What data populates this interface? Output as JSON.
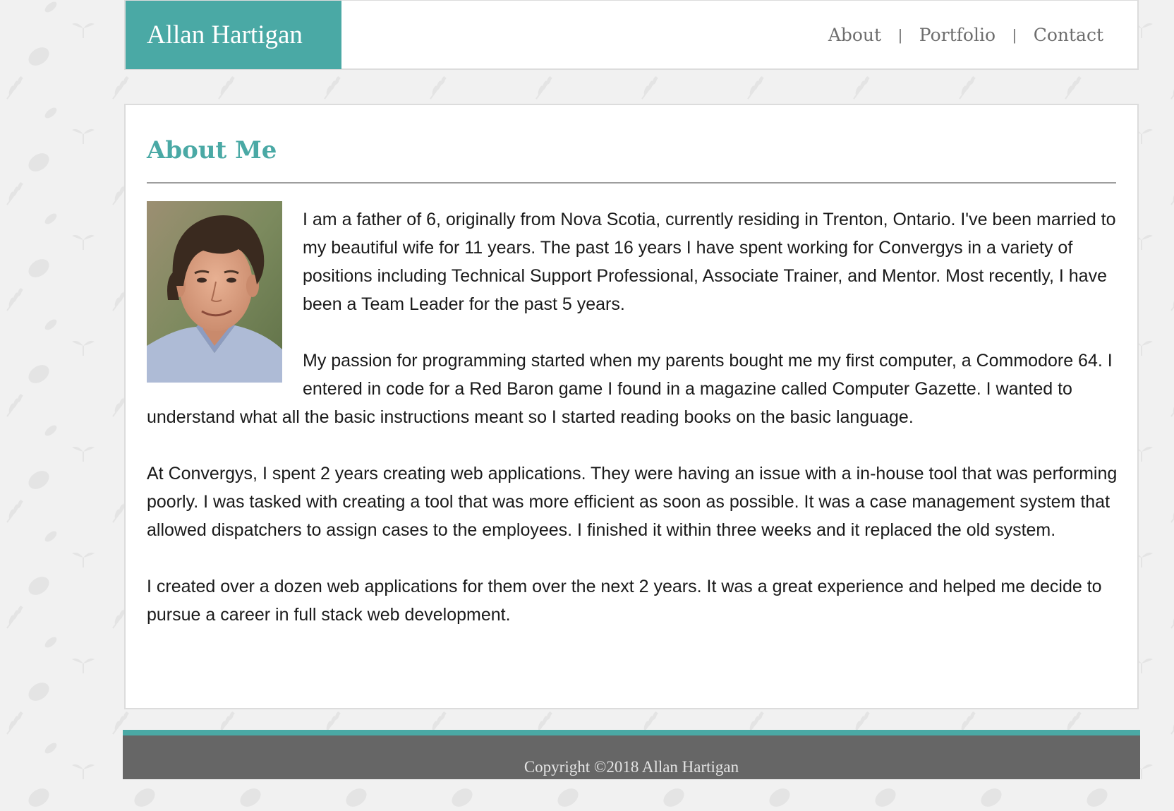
{
  "header": {
    "brand": "Allan Hartigan",
    "nav": [
      {
        "label": "About"
      },
      {
        "label": "Portfolio"
      },
      {
        "label": "Contact"
      }
    ],
    "separator": "|"
  },
  "about": {
    "title": "About Me",
    "photo_icon": "profile-photo",
    "paragraphs": [
      "I am a father of 6, originally from Nova Scotia, currently residing in Trenton, Ontario. I've been married to my beautiful wife for 11 years. The past 16 years I have spent working for Convergys in a variety of positions including Technical Support Professional, Associate Trainer, and Mentor. Most recently, I have been a Team Leader for the past 5 years.",
      "My passion for programming started when my parents bought me my first computer, a Commodore 64. I entered in code for a Red Baron game I found in a magazine called Computer Gazette. I wanted to understand what all the basic instructions meant so I started reading books on the basic language.",
      "At Convergys, I spent 2 years creating web applications. They were having an issue with a in-house tool that was performing poorly. I was tasked with creating a tool that was more efficient as soon as possible. It was a case management system that allowed dispatchers to assign cases to the employees. I finished it within three weeks and it replaced the old system.",
      "I created over a dozen web applications for them over the next 2 years. It was a great experience and helped me decide to pursue a career in full stack web development."
    ]
  },
  "footer": {
    "copyright": "Copyright ©2018 Allan Hartigan"
  },
  "colors": {
    "accent": "#4aa9a5",
    "footer": "#666666",
    "background": "#f1f1f1"
  }
}
